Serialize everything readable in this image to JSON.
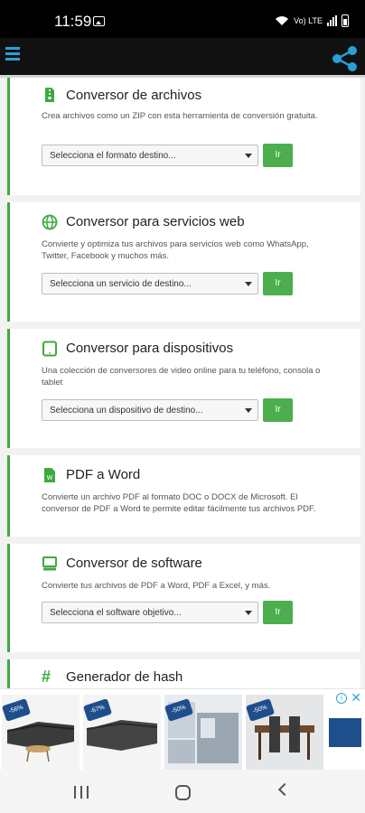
{
  "status_bar": {
    "time": "11:59",
    "indicators": "Vo) LTE"
  },
  "header": {
    "menu_icon": "menu-icon",
    "share_icon": "share-icon",
    "accent": "#2a9fd6"
  },
  "cards": [
    {
      "title": "Conversor de archivos",
      "icon": "file-zip-icon",
      "description": "Crea archivos como un ZIP con esta herramienta de conversión gratuita.",
      "select_text": "Selecciona el formato destino...",
      "button": "Ir"
    },
    {
      "title": "Conversor para servicios web",
      "icon": "globe-icon",
      "description": "Convierte y optimiza tus archivos para servicios web como WhatsApp, Twitter, Facebook y muchos más.",
      "select_text": "Selecciona un servicio de destino...",
      "button": "Ir"
    },
    {
      "title": "Conversor para dispositivos",
      "icon": "tablet-icon",
      "description": "Una colección de conversores de video online para tu teléfono, consola o tablet",
      "select_text": "Selecciona un dispositivo de destino...",
      "button": "Ir"
    },
    {
      "title": "PDF a Word",
      "icon": "word-file-icon",
      "description": "Convierte un archivo PDF al formato DOC o DOCX de Microsoft. El conversor de PDF a Word te permite editar fácilmente tus archivos PDF."
    },
    {
      "title": "Conversor de software",
      "icon": "monitor-icon",
      "description": "Convierte tus archivos de PDF a Word, PDF a Excel, y más.",
      "select_text": "Selecciona el software objetivo...",
      "button": "Ir"
    },
    {
      "title": "Generador de hash",
      "icon": "hash-icon"
    }
  ],
  "ad": {
    "badges": [
      "-56%",
      "-67%",
      "-50%",
      "-50%"
    ],
    "info_icon": "info-icon",
    "close_icon": "close-icon"
  },
  "colors": {
    "green": "#4cae4c",
    "card_border": "#3eaa3e"
  }
}
